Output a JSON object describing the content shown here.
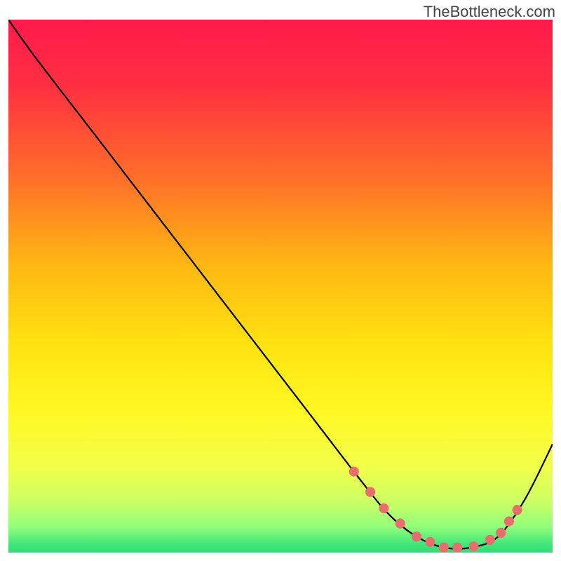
{
  "watermark": "TheBottleneck.com",
  "chart_data": {
    "type": "line",
    "title": "",
    "xlabel": "",
    "ylabel": "",
    "xlim": [
      0,
      1
    ],
    "ylim": [
      0,
      100
    ],
    "series": [
      {
        "name": "curve",
        "x": [
          0.0,
          0.05,
          0.15,
          0.25,
          0.35,
          0.45,
          0.55,
          0.65,
          0.7,
          0.75,
          0.8,
          0.85,
          0.9,
          0.95,
          1.0
        ],
        "values": [
          100,
          93,
          80,
          67,
          54,
          41,
          28,
          15,
          9,
          5,
          3,
          3,
          5,
          12,
          22
        ]
      }
    ],
    "gradient_stops": [
      {
        "offset": 0.0,
        "color": "#ff1a4b"
      },
      {
        "offset": 0.12,
        "color": "#ff2f41"
      },
      {
        "offset": 0.28,
        "color": "#ff6a2b"
      },
      {
        "offset": 0.45,
        "color": "#ffb712"
      },
      {
        "offset": 0.6,
        "color": "#ffe310"
      },
      {
        "offset": 0.72,
        "color": "#fff824"
      },
      {
        "offset": 0.82,
        "color": "#f2ff49"
      },
      {
        "offset": 0.88,
        "color": "#d1ff63"
      },
      {
        "offset": 0.93,
        "color": "#95ff7a"
      },
      {
        "offset": 0.965,
        "color": "#3fe67a"
      },
      {
        "offset": 1.0,
        "color": "#1fd06d"
      }
    ],
    "marker_color": "#e86d6d",
    "marker_radius_px": 7,
    "marker_x": [
      0.635,
      0.665,
      0.69,
      0.72,
      0.75,
      0.775,
      0.8,
      0.825,
      0.855,
      0.885,
      0.905,
      0.92,
      0.935
    ]
  }
}
